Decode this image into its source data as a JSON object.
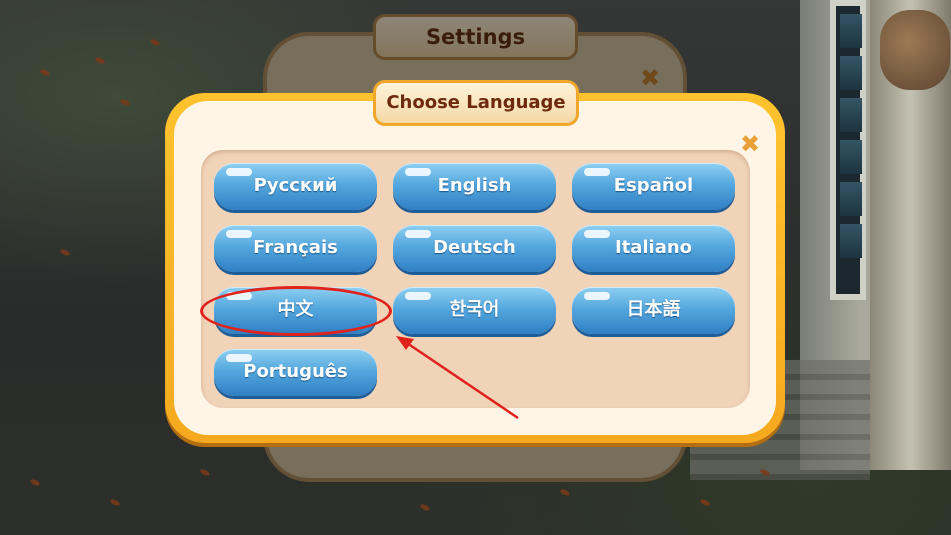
{
  "settings": {
    "title": "Settings"
  },
  "dialog": {
    "title": "Choose Language",
    "close_icon": "close-icon",
    "languages": [
      {
        "label": "Русский"
      },
      {
        "label": "English"
      },
      {
        "label": "Español"
      },
      {
        "label": "Français"
      },
      {
        "label": "Deutsch"
      },
      {
        "label": "Italiano"
      },
      {
        "label": "中文"
      },
      {
        "label": "한국어"
      },
      {
        "label": "日本語"
      },
      {
        "label": "Português"
      }
    ]
  },
  "colors": {
    "button_blue": "#3f93d4",
    "dialog_gold": "#f5b01f",
    "title_text": "#6e2a0c",
    "annotation_red": "#e0221b"
  }
}
